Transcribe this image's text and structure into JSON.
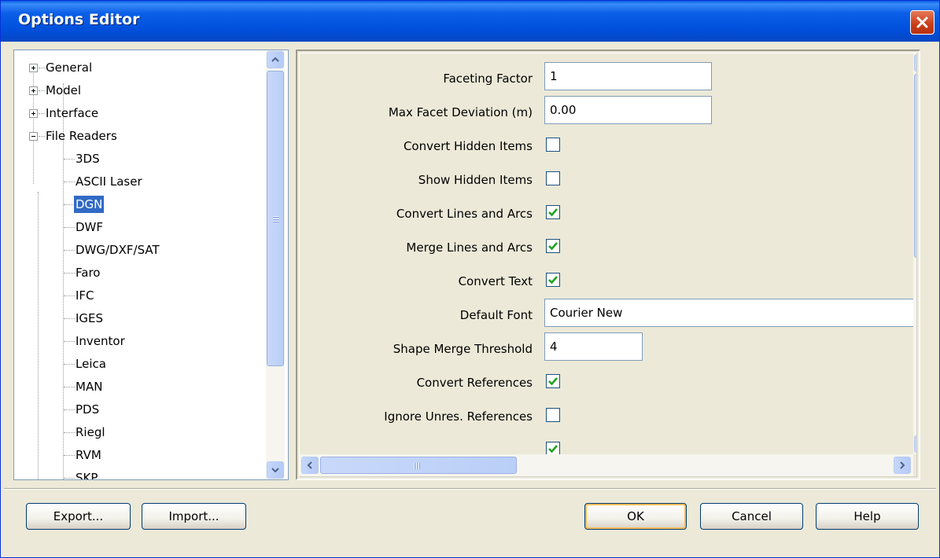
{
  "window": {
    "title": "Options Editor"
  },
  "tree": {
    "top_nodes": [
      {
        "label": "General",
        "expanded": false
      },
      {
        "label": "Model",
        "expanded": false
      },
      {
        "label": "Interface",
        "expanded": false
      },
      {
        "label": "File Readers",
        "expanded": true
      }
    ],
    "children": [
      "3DS",
      "ASCII Laser",
      "DGN",
      "DWF",
      "DWG/DXF/SAT",
      "Faro",
      "IFC",
      "IGES",
      "Inventor",
      "Leica",
      "MAN",
      "PDS",
      "Riegl",
      "RVM",
      "SKP"
    ],
    "selected": "DGN"
  },
  "options": {
    "faceting_factor": {
      "label": "Faceting Factor",
      "value": "1"
    },
    "max_facet_deviation": {
      "label": "Max Facet Deviation (m)",
      "value": "0.00"
    },
    "convert_hidden_items": {
      "label": "Convert Hidden Items",
      "checked": false
    },
    "show_hidden_items": {
      "label": "Show Hidden Items",
      "checked": false
    },
    "convert_lines_arcs": {
      "label": "Convert Lines and Arcs",
      "checked": true
    },
    "merge_lines_arcs": {
      "label": "Merge Lines and Arcs",
      "checked": true
    },
    "convert_text": {
      "label": "Convert Text",
      "checked": true
    },
    "default_font": {
      "label": "Default Font",
      "value": "Courier New"
    },
    "shape_merge_threshold": {
      "label": "Shape Merge Threshold",
      "value": "4"
    },
    "convert_references": {
      "label": "Convert References",
      "checked": true
    },
    "ignore_unres_references": {
      "label": "Ignore Unres. References",
      "checked": false
    },
    "partial_row_checked": true
  },
  "buttons": {
    "export": "Export...",
    "import": "Import...",
    "ok": "OK",
    "cancel": "Cancel",
    "help": "Help"
  },
  "colors": {
    "title_bar": "#0054e3",
    "selection": "#316ac5",
    "dialog_bg": "#ece9d8",
    "check": "#21a121"
  }
}
